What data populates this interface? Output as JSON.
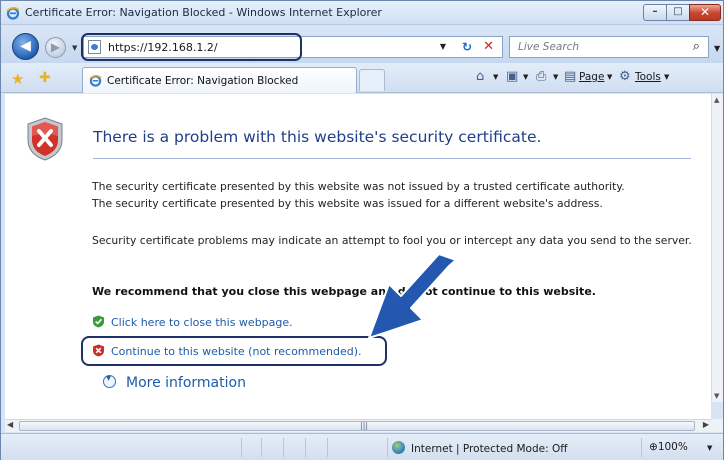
{
  "window": {
    "title": "Certificate Error: Navigation Blocked - Windows Internet Explorer",
    "min_label": "–",
    "max_label": "□",
    "close_label": "✕"
  },
  "nav": {
    "back_glyph": "◀",
    "forward_glyph": "▶",
    "url": "https://192.168.1.2/",
    "refresh_glyph": "⁴⁄",
    "stop_glyph": "✕",
    "search_placeholder": "Live Search",
    "search_glyph": "⚲"
  },
  "tabs": {
    "active_label": "Certificate Error: Navigation Blocked"
  },
  "command_bar": {
    "page_label": "Page",
    "tools_label": "Tools"
  },
  "content": {
    "heading": "There is a problem with this website's security certificate.",
    "para1_line1": "The security certificate presented by this website was not issued by a trusted certificate authority.",
    "para1_line2": "The security certificate presented by this website was issued for a different website's address.",
    "para2": "Security certificate problems may indicate an attempt to fool you or intercept any data you send to the server.",
    "recommend": "We recommend that you close this webpage and do not continue to this website.",
    "close_link": "Click here to close this webpage.",
    "continue_link": "Continue to this website (not recommended).",
    "more_info": "More information"
  },
  "status": {
    "zone": "Internet | Protected Mode: Off",
    "zoom": "100%"
  },
  "colors": {
    "heading": "#1f3e8c",
    "link": "#1d5ba8",
    "callout": "#1f3166",
    "arrow": "#2357b0"
  }
}
